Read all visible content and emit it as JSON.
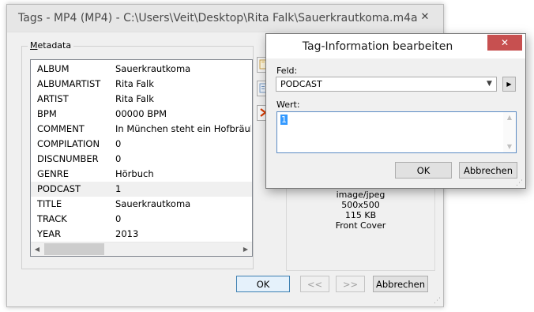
{
  "main_window": {
    "title": "Tags - MP4 (MP4) - C:\\Users\\Veit\\Desktop\\Rita Falk\\Sauerkrautkoma.m4a",
    "close_glyph": "✕",
    "group_label_underlined": "M",
    "group_label_rest": "etadata",
    "metadata": [
      {
        "key": "ALBUM",
        "value": "Sauerkrautkoma"
      },
      {
        "key": "ALBUMARTIST",
        "value": "Rita Falk"
      },
      {
        "key": "ARTIST",
        "value": "Rita Falk"
      },
      {
        "key": "BPM",
        "value": "00000 BPM"
      },
      {
        "key": "COMMENT",
        "value": "In München steht ein Hofbräuhaus"
      },
      {
        "key": "COMPILATION",
        "value": "0"
      },
      {
        "key": "DISCNUMBER",
        "value": "0"
      },
      {
        "key": "GENRE",
        "value": "Hörbuch"
      },
      {
        "key": "PODCAST",
        "value": "1"
      },
      {
        "key": "TITLE",
        "value": "Sauerkrautkoma"
      },
      {
        "key": "TRACK",
        "value": "0"
      },
      {
        "key": "YEAR",
        "value": "2013"
      }
    ],
    "selected_row": "PODCAST",
    "cover_info": {
      "mime": "image/jpeg",
      "dimensions": "500x500",
      "size": "115 KB",
      "type": "Front Cover"
    },
    "buttons": {
      "ok": "OK",
      "prev": "<<",
      "next": ">>",
      "cancel": "Abbrechen"
    }
  },
  "edit_dialog": {
    "title": "Tag-Information bearbeiten",
    "close_glyph": "✕",
    "field_label": "Feld:",
    "field_value": "PODCAST",
    "value_label": "Wert:",
    "value_text": "1",
    "buttons": {
      "ok": "OK",
      "cancel": "Abbrechen"
    }
  },
  "colors": {
    "dialog_close_bg": "#c75050",
    "selection_bg": "#3399ff",
    "remove_icon": "#d83b01",
    "add_icon": "#e8b84a"
  },
  "icons": {
    "add_tag": "add-tag-icon",
    "edit_tag": "edit-tag-icon",
    "remove_tag": "remove-tag-icon"
  }
}
